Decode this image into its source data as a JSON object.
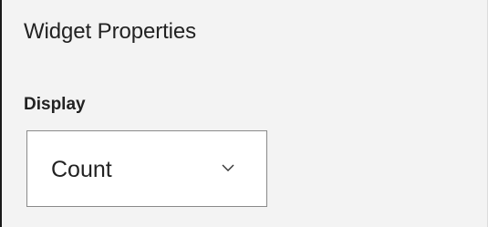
{
  "panel": {
    "title": "Widget Properties"
  },
  "display_field": {
    "label": "Display",
    "selected_value": "Count",
    "icon": "chevron-down-icon"
  }
}
